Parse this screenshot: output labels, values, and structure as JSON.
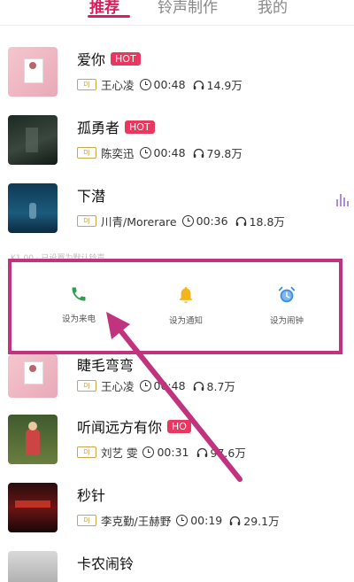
{
  "tabs": [
    {
      "label": "推荐",
      "active": true
    },
    {
      "label": "铃声制作",
      "active": false
    },
    {
      "label": "我的",
      "active": false
    }
  ],
  "hot_label": "HOT",
  "songs": [
    {
      "title": "爱你",
      "hot": true,
      "artist": "王心凌",
      "duration": "00:48",
      "plays": "14.9万"
    },
    {
      "title": "孤勇者",
      "hot": true,
      "artist": "陈奕迅",
      "duration": "00:48",
      "plays": "79.8万"
    },
    {
      "title": "下潜",
      "hot": false,
      "artist": "川青/Morerare",
      "duration": "00:36",
      "plays": "18.8万",
      "playing": true
    },
    {
      "title": "睫毛弯弯",
      "hot": false,
      "artist": "王心凌",
      "duration": "00:48",
      "plays": "8.7万"
    },
    {
      "title": "听闻远方有你",
      "hot": true,
      "hot_text": "HO",
      "artist": "刘艺 雯",
      "duration": "00:31",
      "plays": "97.6万"
    },
    {
      "title": "秒针",
      "hot": false,
      "artist": "李克勤/王赫野",
      "duration": "00:19",
      "plays": "29.1万"
    },
    {
      "title": "卡农闹铃",
      "hot": false,
      "artist": "",
      "duration": "",
      "plays": ""
    }
  ],
  "tag_label": "DJ",
  "actions": {
    "obscured_text": "K1.00  · 已设置为默认铃声",
    "items": [
      {
        "label": "设为来电",
        "icon": "phone-icon",
        "color": "#2e9e4f"
      },
      {
        "label": "设为通知",
        "icon": "bell-icon",
        "color": "#f2b51e"
      },
      {
        "label": "设为闹钟",
        "icon": "alarm-clock-icon",
        "color": "#3a8ee6"
      }
    ]
  },
  "colors": {
    "accent": "#d81e5b",
    "hot": "#e8385f",
    "highlight_box": "#c2337f"
  }
}
